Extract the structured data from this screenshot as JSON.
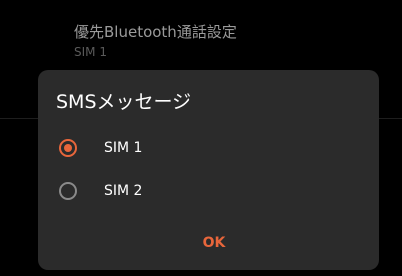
{
  "background_item": {
    "title": "優先Bluetooth通話設定",
    "subtitle": "SIM 1"
  },
  "dialog": {
    "title": "SMSメッセージ",
    "options": [
      {
        "label": "SIM 1",
        "selected": true
      },
      {
        "label": "SIM 2",
        "selected": false
      }
    ],
    "ok_label": "OK"
  },
  "colors": {
    "accent": "#e8663b",
    "dialog_background": "#2b2b2b",
    "screen_background": "#000000"
  }
}
